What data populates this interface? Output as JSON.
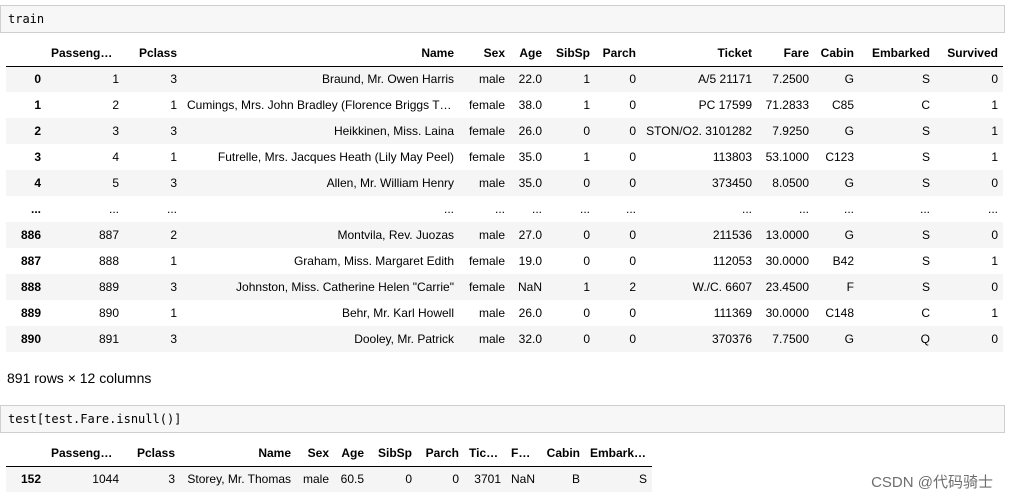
{
  "cells": [
    {
      "code": "train"
    },
    {
      "code": "test[test.Fare.isnull()]"
    }
  ],
  "train": {
    "columns": [
      "",
      "PassengerId",
      "Pclass",
      "Name",
      "Sex",
      "Age",
      "SibSp",
      "Parch",
      "Ticket",
      "Fare",
      "Cabin",
      "Embarked",
      "Survived"
    ],
    "rows": [
      [
        "0",
        "1",
        "3",
        "Braund, Mr. Owen Harris",
        "male",
        "22.0",
        "1",
        "0",
        "A/5 21171",
        "7.2500",
        "G",
        "S",
        "0"
      ],
      [
        "1",
        "2",
        "1",
        "Cumings, Mrs. John Bradley (Florence Briggs Th...",
        "female",
        "38.0",
        "1",
        "0",
        "PC 17599",
        "71.2833",
        "C85",
        "C",
        "1"
      ],
      [
        "2",
        "3",
        "3",
        "Heikkinen, Miss. Laina",
        "female",
        "26.0",
        "0",
        "0",
        "STON/O2. 3101282",
        "7.9250",
        "G",
        "S",
        "1"
      ],
      [
        "3",
        "4",
        "1",
        "Futrelle, Mrs. Jacques Heath (Lily May Peel)",
        "female",
        "35.0",
        "1",
        "0",
        "113803",
        "53.1000",
        "C123",
        "S",
        "1"
      ],
      [
        "4",
        "5",
        "3",
        "Allen, Mr. William Henry",
        "male",
        "35.0",
        "0",
        "0",
        "373450",
        "8.0500",
        "G",
        "S",
        "0"
      ],
      [
        "...",
        "...",
        "...",
        "...",
        "...",
        "...",
        "...",
        "...",
        "...",
        "...",
        "...",
        "...",
        "..."
      ],
      [
        "886",
        "887",
        "2",
        "Montvila, Rev. Juozas",
        "male",
        "27.0",
        "0",
        "0",
        "211536",
        "13.0000",
        "G",
        "S",
        "0"
      ],
      [
        "887",
        "888",
        "1",
        "Graham, Miss. Margaret Edith",
        "female",
        "19.0",
        "0",
        "0",
        "112053",
        "30.0000",
        "B42",
        "S",
        "1"
      ],
      [
        "888",
        "889",
        "3",
        "Johnston, Miss. Catherine Helen \"Carrie\"",
        "female",
        "NaN",
        "1",
        "2",
        "W./C. 6607",
        "23.4500",
        "F",
        "S",
        "0"
      ],
      [
        "889",
        "890",
        "1",
        "Behr, Mr. Karl Howell",
        "male",
        "26.0",
        "0",
        "0",
        "111369",
        "30.0000",
        "C148",
        "C",
        "1"
      ],
      [
        "890",
        "891",
        "3",
        "Dooley, Mr. Patrick",
        "male",
        "32.0",
        "0",
        "0",
        "370376",
        "7.7500",
        "G",
        "Q",
        "0"
      ]
    ],
    "summary": "891 rows × 12 columns"
  },
  "test": {
    "columns": [
      "",
      "PassengerId",
      "Pclass",
      "Name",
      "Sex",
      "Age",
      "SibSp",
      "Parch",
      "Ticket",
      "Fare",
      "Cabin",
      "Embarked"
    ],
    "rows": [
      [
        "152",
        "1044",
        "3",
        "Storey, Mr. Thomas",
        "male",
        "60.5",
        "0",
        "0",
        "3701",
        "NaN",
        "B",
        "S"
      ]
    ]
  },
  "watermark": "CSDN @代码骑士"
}
